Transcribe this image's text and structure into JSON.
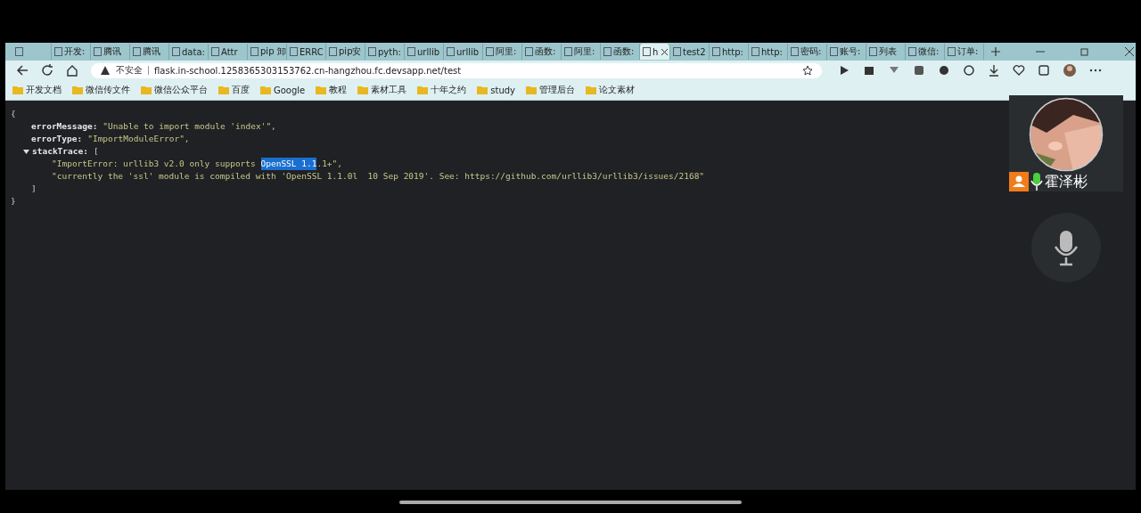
{
  "tabs": [
    {
      "selected": false
    },
    {
      "label": "开发:",
      "selected": false
    },
    {
      "label": "腾讯",
      "selected": false
    },
    {
      "label": "腾讯",
      "selected": false
    },
    {
      "label": "data:",
      "selected": false
    },
    {
      "label": "Attr",
      "selected": false
    },
    {
      "label": "pip 卸",
      "selected": false
    },
    {
      "label": "ERRC",
      "selected": false
    },
    {
      "label": "pip安",
      "selected": false
    },
    {
      "label": "pyth:",
      "selected": false
    },
    {
      "label": "urllib",
      "selected": false
    },
    {
      "label": "urllib",
      "selected": false
    },
    {
      "label": "阿里:",
      "selected": false
    },
    {
      "label": "函数:",
      "selected": false
    },
    {
      "label": "阿里:",
      "selected": false
    },
    {
      "label": "函数:",
      "selected": false
    },
    {
      "label": "h",
      "selected": true
    },
    {
      "label": "test2",
      "selected": false
    },
    {
      "label": "http:",
      "selected": false
    },
    {
      "label": "http:",
      "selected": false
    },
    {
      "label": "密码:",
      "selected": false
    },
    {
      "label": "账号:",
      "selected": false
    },
    {
      "label": "列表",
      "selected": false
    },
    {
      "label": "微信:",
      "selected": false
    },
    {
      "label": "订单:",
      "selected": false
    }
  ],
  "address_bar": {
    "security": "不安全",
    "url": "flask.in-school.1258365303153762.cn-hangzhou.fc.devsapp.net/test"
  },
  "bookmarks": [
    "开发文档",
    "微信传文件",
    "微信公众平台",
    "百度",
    "Google",
    "教程",
    "素材工具",
    "十年之约",
    "study",
    "管理后台",
    "论文素材"
  ],
  "json_view": [
    {
      "kind": "brace",
      "text": "{"
    },
    {
      "kind": "field",
      "key": "errorMessage:",
      "value": "\"Unable to import module 'index'\","
    },
    {
      "kind": "field",
      "key": "errorType:",
      "value": "\"ImportModuleError\","
    },
    {
      "kind": "array",
      "key": "stackTrace:",
      "value": "[",
      "expanded": true
    },
    {
      "kind": "item",
      "parts": [
        {
          "text": "\"ImportError: urllib3 v2.0 only supports ",
          "selected": false
        },
        {
          "text": "OpenSSL 1.1",
          "selected": true
        },
        {
          "text": ".1+\",",
          "selected": false
        }
      ]
    },
    {
      "kind": "item",
      "parts": [
        {
          "text": "\"currently the 'ssl' module is compiled with 'OpenSSL 1.1.0l  10 Sep 2019'. See: https://github.com/urllib3/urllib3/issues/2168\"",
          "selected": false
        }
      ]
    },
    {
      "kind": "close",
      "text": "]"
    },
    {
      "kind": "brace",
      "text": "}"
    }
  ],
  "call_overlay": {
    "participant": "霍泽彬",
    "mic_on": true
  }
}
